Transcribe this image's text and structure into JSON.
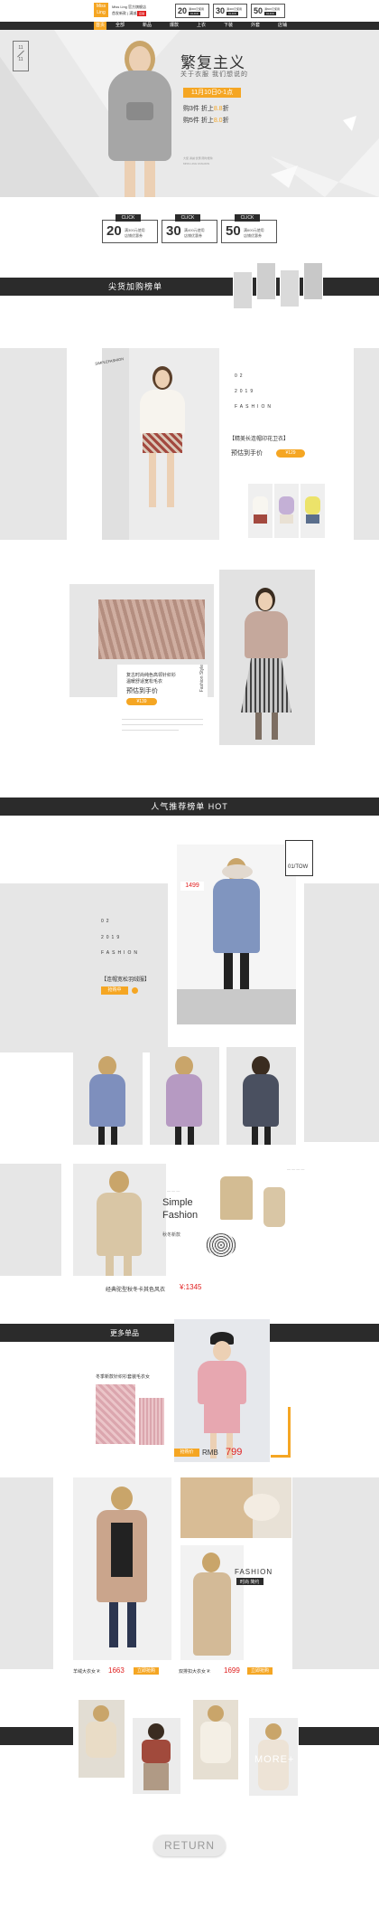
{
  "header": {
    "logo_line1": "Miss",
    "logo_line2": "Ling",
    "brand_text1": "Miss Ling 官方旗舰店",
    "brand_text2": "首发新款 | 满减活动 ",
    "brand_badge": "店铺",
    "coupons_small": [
      {
        "num": "20",
        "text1": "满300元使用",
        "text2": "CLICK"
      },
      {
        "num": "30",
        "text1": "满400元使用",
        "text2": "CLICK"
      },
      {
        "num": "50",
        "text1": "满600元使用",
        "text2": "CLICK"
      }
    ],
    "nav": [
      "首页",
      "全部",
      "新品",
      "爆款",
      "上衣",
      "下装",
      "外套",
      "店铺"
    ]
  },
  "hero": {
    "date_top": "11",
    "date_bottom": "11",
    "title": "繁复主义",
    "subtitle": "关于衣服 我们想说的",
    "time_badge": "11月10日0-1点",
    "line1_prefix": "购3件 折上",
    "line1_value": "8.8",
    "line1_suffix": "折",
    "line2_prefix": "购5件 折上",
    "line2_value": "8.0",
    "line2_suffix": "折",
    "small_text1": "大促 满减 优惠 限时抢购",
    "small_text2": "MISS LING FASHION"
  },
  "coupons": [
    {
      "click": "CLICK",
      "num": "20",
      "line1": "满300元使用",
      "line2": "店铺优惠券"
    },
    {
      "click": "CLICK",
      "num": "30",
      "line1": "满400元使用",
      "line2": "店铺优惠券"
    },
    {
      "click": "CLICK",
      "num": "50",
      "line1": "满600元使用",
      "line2": "店铺优惠券"
    }
  ],
  "section1": {
    "bar_title": "尖货加购榜单",
    "year_no": "02",
    "year": "2019",
    "fashion": "FASHION",
    "product_name": "【精美长连帽印花卫衣】",
    "price_label": "预估到手价",
    "price_badge": "¥129",
    "brand_script": "SIMPLEFASHION",
    "product2_name1": "复古时尚纯色高领针织衫",
    "product2_name2": "温暖舒适宽松毛衣",
    "product2_price_label": "预估到手价",
    "product2_badge": "¥139",
    "vertical_text": "Fashion Style"
  },
  "section2": {
    "bar_title": "人气推荐榜单 HOT",
    "price_flag": "1499",
    "rank": "01/TOW",
    "year_no": "02",
    "year": "2019",
    "fashion": "FASHION",
    "product_name": "【连帽宽松羽绒服】",
    "badge": "抢购中",
    "simple1": "Simple",
    "simple2": "Fashion",
    "small_label": "秋冬新款",
    "coat_name": "经典驼型秋冬卡其色风衣",
    "coat_price": "¥:1345"
  },
  "section3": {
    "bar_title": "更多单品",
    "knit_text": "冬季新款针织衫套装毛衣女",
    "price_badge": "抢购价",
    "rmb_label": "RMB",
    "price": "799",
    "coat1_label": "羊绒大衣女 ¥:",
    "coat1_price": "1663",
    "coat1_btn": "立即抢购",
    "coat2_label": "双排扣大衣女 ¥:",
    "coat2_price": "1699",
    "coat2_btn": "立即抢购",
    "fashion": "FASHION",
    "fashion_sub": "时尚 简约"
  },
  "more": {
    "more_text": "MORE+",
    "return_label": "RETURN"
  },
  "colors": {
    "accent": "#f5a623",
    "dark": "#2b2b2b",
    "gray": "#e6e6e6"
  }
}
